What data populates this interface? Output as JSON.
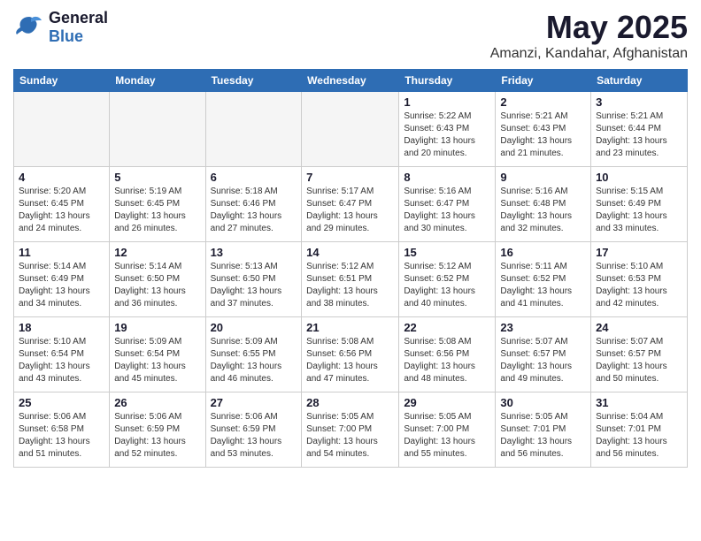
{
  "header": {
    "logo": {
      "general": "General",
      "blue": "Blue"
    },
    "title": "May 2025",
    "location": "Amanzi, Kandahar, Afghanistan"
  },
  "calendar": {
    "weekdays": [
      "Sunday",
      "Monday",
      "Tuesday",
      "Wednesday",
      "Thursday",
      "Friday",
      "Saturday"
    ],
    "weeks": [
      [
        {
          "day": "",
          "info": ""
        },
        {
          "day": "",
          "info": ""
        },
        {
          "day": "",
          "info": ""
        },
        {
          "day": "",
          "info": ""
        },
        {
          "day": "1",
          "info": "Sunrise: 5:22 AM\nSunset: 6:43 PM\nDaylight: 13 hours and 20 minutes."
        },
        {
          "day": "2",
          "info": "Sunrise: 5:21 AM\nSunset: 6:43 PM\nDaylight: 13 hours and 21 minutes."
        },
        {
          "day": "3",
          "info": "Sunrise: 5:21 AM\nSunset: 6:44 PM\nDaylight: 13 hours and 23 minutes."
        }
      ],
      [
        {
          "day": "4",
          "info": "Sunrise: 5:20 AM\nSunset: 6:45 PM\nDaylight: 13 hours and 24 minutes."
        },
        {
          "day": "5",
          "info": "Sunrise: 5:19 AM\nSunset: 6:45 PM\nDaylight: 13 hours and 26 minutes."
        },
        {
          "day": "6",
          "info": "Sunrise: 5:18 AM\nSunset: 6:46 PM\nDaylight: 13 hours and 27 minutes."
        },
        {
          "day": "7",
          "info": "Sunrise: 5:17 AM\nSunset: 6:47 PM\nDaylight: 13 hours and 29 minutes."
        },
        {
          "day": "8",
          "info": "Sunrise: 5:16 AM\nSunset: 6:47 PM\nDaylight: 13 hours and 30 minutes."
        },
        {
          "day": "9",
          "info": "Sunrise: 5:16 AM\nSunset: 6:48 PM\nDaylight: 13 hours and 32 minutes."
        },
        {
          "day": "10",
          "info": "Sunrise: 5:15 AM\nSunset: 6:49 PM\nDaylight: 13 hours and 33 minutes."
        }
      ],
      [
        {
          "day": "11",
          "info": "Sunrise: 5:14 AM\nSunset: 6:49 PM\nDaylight: 13 hours and 34 minutes."
        },
        {
          "day": "12",
          "info": "Sunrise: 5:14 AM\nSunset: 6:50 PM\nDaylight: 13 hours and 36 minutes."
        },
        {
          "day": "13",
          "info": "Sunrise: 5:13 AM\nSunset: 6:50 PM\nDaylight: 13 hours and 37 minutes."
        },
        {
          "day": "14",
          "info": "Sunrise: 5:12 AM\nSunset: 6:51 PM\nDaylight: 13 hours and 38 minutes."
        },
        {
          "day": "15",
          "info": "Sunrise: 5:12 AM\nSunset: 6:52 PM\nDaylight: 13 hours and 40 minutes."
        },
        {
          "day": "16",
          "info": "Sunrise: 5:11 AM\nSunset: 6:52 PM\nDaylight: 13 hours and 41 minutes."
        },
        {
          "day": "17",
          "info": "Sunrise: 5:10 AM\nSunset: 6:53 PM\nDaylight: 13 hours and 42 minutes."
        }
      ],
      [
        {
          "day": "18",
          "info": "Sunrise: 5:10 AM\nSunset: 6:54 PM\nDaylight: 13 hours and 43 minutes."
        },
        {
          "day": "19",
          "info": "Sunrise: 5:09 AM\nSunset: 6:54 PM\nDaylight: 13 hours and 45 minutes."
        },
        {
          "day": "20",
          "info": "Sunrise: 5:09 AM\nSunset: 6:55 PM\nDaylight: 13 hours and 46 minutes."
        },
        {
          "day": "21",
          "info": "Sunrise: 5:08 AM\nSunset: 6:56 PM\nDaylight: 13 hours and 47 minutes."
        },
        {
          "day": "22",
          "info": "Sunrise: 5:08 AM\nSunset: 6:56 PM\nDaylight: 13 hours and 48 minutes."
        },
        {
          "day": "23",
          "info": "Sunrise: 5:07 AM\nSunset: 6:57 PM\nDaylight: 13 hours and 49 minutes."
        },
        {
          "day": "24",
          "info": "Sunrise: 5:07 AM\nSunset: 6:57 PM\nDaylight: 13 hours and 50 minutes."
        }
      ],
      [
        {
          "day": "25",
          "info": "Sunrise: 5:06 AM\nSunset: 6:58 PM\nDaylight: 13 hours and 51 minutes."
        },
        {
          "day": "26",
          "info": "Sunrise: 5:06 AM\nSunset: 6:59 PM\nDaylight: 13 hours and 52 minutes."
        },
        {
          "day": "27",
          "info": "Sunrise: 5:06 AM\nSunset: 6:59 PM\nDaylight: 13 hours and 53 minutes."
        },
        {
          "day": "28",
          "info": "Sunrise: 5:05 AM\nSunset: 7:00 PM\nDaylight: 13 hours and 54 minutes."
        },
        {
          "day": "29",
          "info": "Sunrise: 5:05 AM\nSunset: 7:00 PM\nDaylight: 13 hours and 55 minutes."
        },
        {
          "day": "30",
          "info": "Sunrise: 5:05 AM\nSunset: 7:01 PM\nDaylight: 13 hours and 56 minutes."
        },
        {
          "day": "31",
          "info": "Sunrise: 5:04 AM\nSunset: 7:01 PM\nDaylight: 13 hours and 56 minutes."
        }
      ]
    ]
  }
}
